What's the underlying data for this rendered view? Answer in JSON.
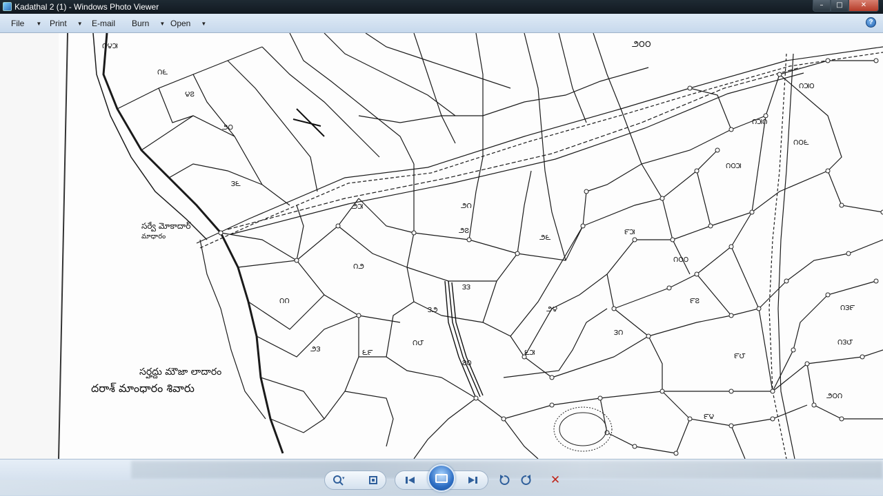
{
  "window": {
    "title": "Kadathal 2 (1) - Windows Photo Viewer",
    "controls": {
      "minimize": "–",
      "maximize": "□",
      "close": "✕"
    }
  },
  "menu": {
    "file": "File",
    "print": "Print",
    "email": "E-mail",
    "burn": "Burn",
    "open": "Open",
    "help": "?"
  },
  "map": {
    "marginal_note_line1": "సర్వే మోకాదార్",
    "marginal_note_line2": "మాధారం",
    "bottom_note_line1": "సర్హద్దు మౌజా లాదారం",
    "bottom_note_line2": "దరాశ్ మాంధారం శివారు",
    "numbers": [
      "౧౪౫",
      "౧౬",
      "౪౭",
      "౨౦",
      "౩౬",
      "౨౫",
      "౨౧",
      "౨౭",
      "౨౬",
      "౩౨",
      "౩౩",
      "౨౪",
      "౧౨",
      "౧౧",
      "౨౩",
      "౬౯",
      "౧౮",
      "౭౦",
      "౬౫",
      "౯౫",
      "౧౦౦",
      "౯౭",
      "౯౮",
      "౧౫౦",
      "౧౫౧",
      "౧౦౬",
      "౧౦౫",
      "౧౩౮",
      "౧౩౯",
      "౩౧",
      "౯౪",
      "౨౦౦",
      "౨౦౧"
    ]
  },
  "toolbar": {
    "zoom": "zoom-icon",
    "fit": "fit-to-window-icon",
    "previous": "previous-icon",
    "slideshow": "slideshow-icon",
    "next": "next-icon",
    "rotate_ccw": "rotate-counterclockwise-icon",
    "rotate_cw": "rotate-clockwise-icon",
    "delete": "delete-icon"
  }
}
